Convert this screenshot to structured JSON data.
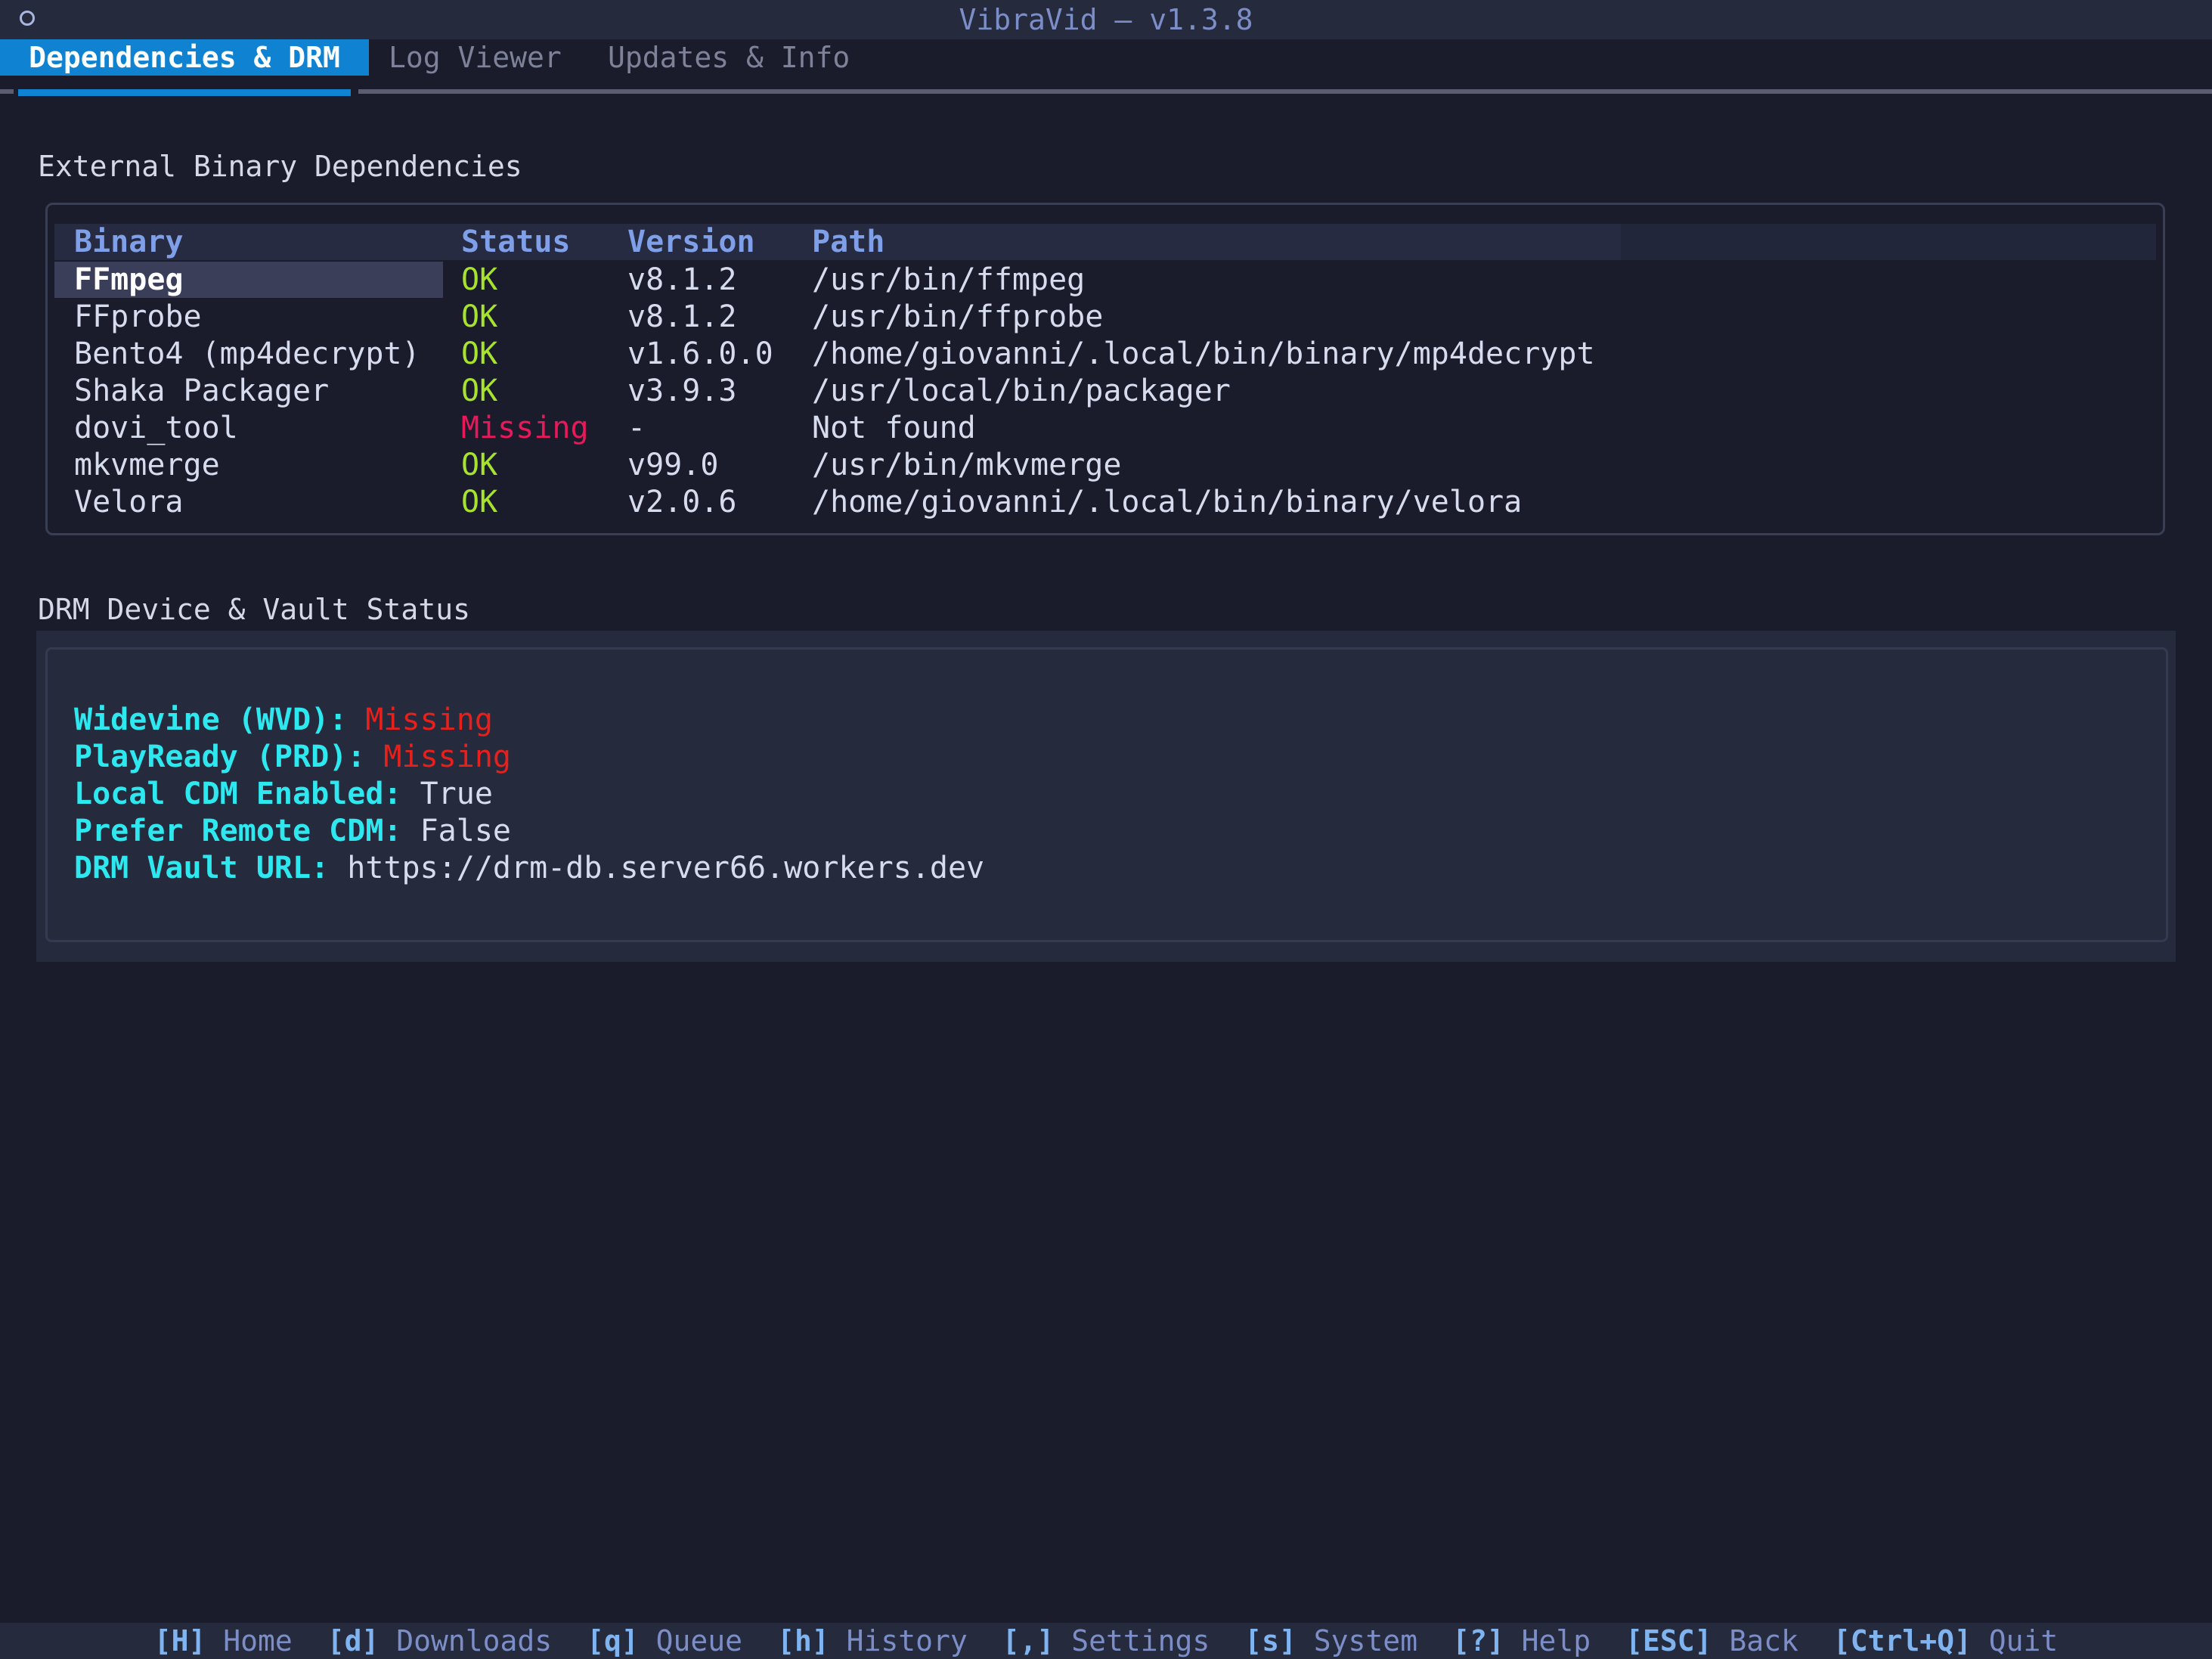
{
  "window": {
    "title": "VibraVid — v1.3.8"
  },
  "tabs": [
    {
      "label": "Dependencies & DRM",
      "active": true
    },
    {
      "label": "Log Viewer",
      "active": false
    },
    {
      "label": "Updates & Info",
      "active": false
    }
  ],
  "deps": {
    "title": "External Binary Dependencies",
    "columns": [
      "Binary",
      "Status",
      "Version",
      "Path"
    ],
    "rows": [
      {
        "binary": "FFmpeg",
        "status": "OK",
        "version": "v8.1.2",
        "path": "/usr/bin/ffmpeg",
        "selected": true
      },
      {
        "binary": "FFprobe",
        "status": "OK",
        "version": "v8.1.2",
        "path": "/usr/bin/ffprobe"
      },
      {
        "binary": "Bento4 (mp4decrypt)",
        "status": "OK",
        "version": "v1.6.0.0",
        "path": "/home/giovanni/.local/bin/binary/mp4decrypt"
      },
      {
        "binary": "Shaka Packager",
        "status": "OK",
        "version": "v3.9.3",
        "path": "/usr/local/bin/packager"
      },
      {
        "binary": "dovi_tool",
        "status": "Missing",
        "version": "-",
        "path": "Not found"
      },
      {
        "binary": "mkvmerge",
        "status": "OK",
        "version": "v99.0",
        "path": "/usr/bin/mkvmerge"
      },
      {
        "binary": "Velora",
        "status": "OK",
        "version": "v2.0.6",
        "path": "/home/giovanni/.local/bin/binary/velora"
      }
    ]
  },
  "drm": {
    "title": "DRM Device & Vault Status",
    "items": [
      {
        "key": "Widevine (WVD):",
        "value": "Missing",
        "state": "missing"
      },
      {
        "key": "PlayReady (PRD):",
        "value": "Missing",
        "state": "missing"
      },
      {
        "key": "Local CDM Enabled:",
        "value": "True",
        "state": "normal"
      },
      {
        "key": "Prefer Remote CDM:",
        "value": "False",
        "state": "normal"
      },
      {
        "key": "DRM Vault URL:",
        "value": "https://drm-db.server66.workers.dev",
        "state": "normal"
      }
    ]
  },
  "footer": {
    "shortcuts": [
      {
        "key": "[H]",
        "label": "Home"
      },
      {
        "key": "[d]",
        "label": "Downloads"
      },
      {
        "key": "[q]",
        "label": "Queue"
      },
      {
        "key": "[h]",
        "label": "History"
      },
      {
        "key": "[,]",
        "label": "Settings"
      },
      {
        "key": "[s]",
        "label": "System"
      },
      {
        "key": "[?]",
        "label": "Help"
      },
      {
        "key": "[ESC]",
        "label": "Back"
      },
      {
        "key": "[Ctrl+Q]",
        "label": "Quit"
      }
    ]
  },
  "colors": {
    "background": "#1b1c2b",
    "accent": "#0f82d1",
    "ok": "#a6e22e",
    "missing": "#e8185a",
    "drm_key": "#2ee8f0"
  }
}
